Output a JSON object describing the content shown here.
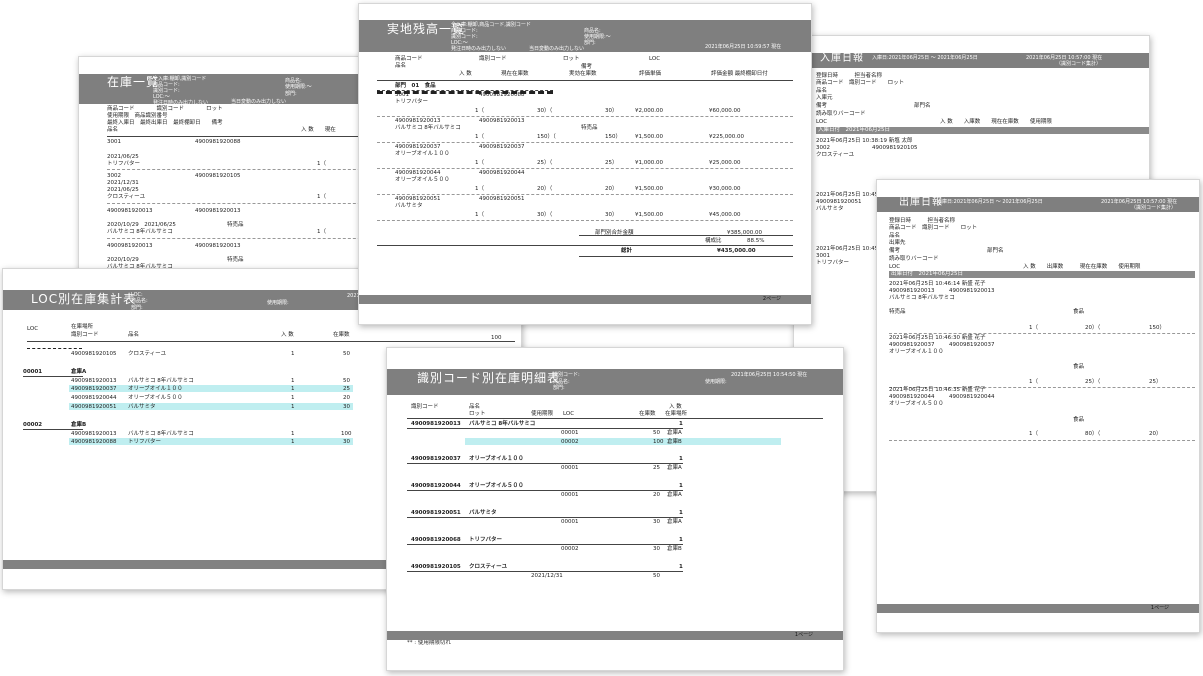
{
  "zaiko": {
    "title": "在庫一覧",
    "hdr_l": [
      "全入庫:棚卸,識別コード",
      "商品コード:",
      "識別コード:",
      "LOC:〜",
      "発注日時のみ出力しない"
    ],
    "hdr_m": "当日変動のみ出力しない",
    "hdr_r": [
      "商品名:",
      "使用期限:〜",
      "部門:"
    ],
    "cols1": [
      "商品コード",
      "識別コード",
      "ロット"
    ],
    "cols2": [
      "使用期限",
      "商品識別番号"
    ],
    "cols3": [
      "最終入庫日",
      "最終出庫日",
      "最終棚卸日",
      "備考"
    ],
    "cols4": [
      "品名",
      "入 数",
      "現在"
    ],
    "rows": [
      {
        "a": "3001",
        "b": "4900981920088"
      },
      {
        "a": "2021/06/25"
      },
      {
        "a": "トリフバター",
        "q": "1（"
      },
      {
        "a": "3002",
        "b": "4900981920105"
      },
      {
        "a": "2021/12/31"
      },
      {
        "a": "2021/06/25"
      },
      {
        "a": "クロスティーユ",
        "q": "1（"
      },
      {
        "a": "4900981920013",
        "b": "4900981920013"
      },
      {
        "a": "2020/10/29　2021/06/25",
        "c": "特売品"
      },
      {
        "a": "バルサミコ 8年バルサミコ",
        "q": "1（"
      },
      {
        "a": "4900981920013",
        "b": "4900981920013"
      },
      {
        "a": "2020/10/29",
        "c": "特売品"
      },
      {
        "a": "バルサミコ 8年バルサミコ"
      }
    ]
  },
  "jitchi": {
    "title": "実地残高一覧",
    "hdr_l": [
      "全入庫:棚卸,商品コード,識別コード",
      "商品コード:",
      "識別コード:",
      "LOC:〜",
      "発注日時のみ出力しない"
    ],
    "hdr_m": "当日変動のみ出力しない",
    "hdr_r": [
      "商品名:",
      "使用期限:〜",
      "部門:"
    ],
    "date": "2021年06月25日 10:59:57 現在",
    "cols1": [
      "商品コード",
      "識別コード",
      "ロット",
      "LOC"
    ],
    "cols2": [
      "品名",
      "備考"
    ],
    "cols3": [
      "入 数",
      "現在在庫数",
      "実効在庫数",
      "評価単価",
      "評価金額 最終棚卸日付"
    ],
    "dept": "部門　01　食品",
    "items": [
      {
        "code": "3001",
        "id": "4900981920088",
        "name": "トリフバター",
        "memo": "",
        "q": "1（",
        "c1": "30）（",
        "c2": "30）",
        "price": "¥2,000.00",
        "amt": "¥60,000.00"
      },
      {
        "code": "4900981920013",
        "id": "4900981920013",
        "name": "バルサミコ 8年バルサミコ",
        "memo": "特売品",
        "q": "1（",
        "c1": "150）（",
        "c2": "150）",
        "price": "¥1,500.00",
        "amt": "¥225,000.00"
      },
      {
        "code": "4900981920037",
        "id": "4900981920037",
        "name": "オリーブオイル１００",
        "memo": "",
        "q": "1（",
        "c1": "25）（",
        "c2": "25）",
        "price": "¥1,000.00",
        "amt": "¥25,000.00"
      },
      {
        "code": "4900981920044",
        "id": "4900981920044",
        "name": "オリーブオイル５００",
        "memo": "",
        "q": "1（",
        "c1": "20）（",
        "c2": "20）",
        "price": "¥1,500.00",
        "amt": "¥30,000.00"
      },
      {
        "code": "4900981920051",
        "id": "4900981920051",
        "name": "バルサミタ",
        "memo": "",
        "q": "1（",
        "c1": "30）（",
        "c2": "30）",
        "price": "¥1,500.00",
        "amt": "¥45,000.00"
      }
    ],
    "subtotal_label": "部門別合計金額",
    "subtotal": "¥385,000.00",
    "ratio_label": "構成比",
    "ratio": "88.5%",
    "total_label": "総計",
    "total": "¥435,000.00",
    "page": "2ページ"
  },
  "nyuko": {
    "title": "入庫日報",
    "hdr": "入庫日:2021年06月25日 〜 2021年06月25日",
    "date": "2021年06月25日 10:57:00 現在",
    "sub": "（識別コード集計）",
    "lbl1": [
      "登録日時",
      "担当者名称"
    ],
    "lbl2": [
      "商品コード",
      "識別コード",
      "ロット"
    ],
    "lbl3": [
      "品名",
      "入庫元"
    ],
    "lbl4": [
      "備考",
      "部門名"
    ],
    "lbl5": [
      "読み取りバーコード"
    ],
    "lbl6": [
      "LOC",
      "入 数",
      "入庫数",
      "現在在庫数",
      "使用期限"
    ],
    "grp": "入庫日付　2021年06月25日",
    "r1": "2021年06月25日 10:38:19 新塩 太郎",
    "r2": "3002",
    "r2b": "4900981920105",
    "r3": "クロスティーユ",
    "r4": "2021年06月25日 10:45:1",
    "r5": "4900981920051",
    "r6": "バルサミタ",
    "r7": "2021年06月25日 10:45:1",
    "r8": "3001",
    "r9": "トリフバター"
  },
  "loc": {
    "title": "LOC別在庫集計表",
    "hdr_l": [
      "LOC:",
      "商品名:",
      "部門:"
    ],
    "hdr_r": "使用期限:",
    "date": "2021",
    "cols1": [
      "在庫場所"
    ],
    "cols2": [
      "LOC",
      "識別コード",
      "品名",
      "入 数",
      "在庫数"
    ],
    "side": "100",
    "rows0": [
      {
        "id": "4900981920105",
        "name": "クロスティーユ",
        "q": "1",
        "n": "50"
      }
    ],
    "g1": "00001",
    "g1n": "倉庫A",
    "rows1": [
      {
        "id": "4900981920013",
        "name": "バルサミコ 8年バルサミコ",
        "q": "1",
        "n": "50"
      },
      {
        "id": "4900981920037",
        "name": "オリーブオイル１００",
        "q": "1",
        "n": "25"
      },
      {
        "id": "4900981920044",
        "name": "オリーブオイル５００",
        "q": "1",
        "n": "20"
      },
      {
        "id": "4900981920051",
        "name": "バルサミタ",
        "q": "1",
        "n": "30"
      }
    ],
    "g2": "00002",
    "g2n": "倉庫B",
    "rows2": [
      {
        "id": "4900981920013",
        "name": "バルサミコ 8年バルサミコ",
        "q": "1",
        "n": "100"
      },
      {
        "id": "4900981920088",
        "name": "トリフバター",
        "q": "1",
        "n": "30"
      }
    ]
  },
  "shiki": {
    "title": "識別コード別在庫明細表",
    "hdr_l": [
      "識別コード:",
      "商品名:",
      "部門:"
    ],
    "hdr_r": "使用期限:",
    "date": "2021年06月25日 10:54:50 現在",
    "cols": [
      "識別コード",
      "品名",
      "入 数"
    ],
    "cols2": [
      "ロット",
      "使用期限",
      "LOC",
      "在庫数",
      "在庫場所"
    ],
    "items": [
      {
        "id": "4900981920013",
        "name": "バルサミコ 8年バルサミコ",
        "q": "1",
        "rows": [
          {
            "loc": "00001",
            "n": "50",
            "p": "倉庫A"
          },
          {
            "loc": "00002",
            "n": "100",
            "p": "倉庫B"
          }
        ]
      },
      {
        "id": "4900981920037",
        "name": "オリーブオイル１００",
        "q": "1",
        "rows": [
          {
            "loc": "00001",
            "n": "25",
            "p": "倉庫A"
          }
        ]
      },
      {
        "id": "4900981920044",
        "name": "オリーブオイル５００",
        "q": "1",
        "rows": [
          {
            "loc": "00001",
            "n": "20",
            "p": "倉庫A"
          }
        ]
      },
      {
        "id": "4900981920051",
        "name": "バルサミタ",
        "q": "1",
        "rows": [
          {
            "loc": "00001",
            "n": "30",
            "p": "倉庫A"
          }
        ]
      },
      {
        "id": "4900981920068",
        "name": "トリフバター",
        "q": "1",
        "rows": [
          {
            "loc": "00002",
            "n": "30",
            "p": "倉庫B"
          }
        ]
      },
      {
        "id": "4900981920105",
        "name": "クロスティーユ",
        "q": "1",
        "rows": [
          {
            "lot": "2021/12/31",
            "n": "50"
          }
        ]
      }
    ],
    "note": "** : 使用期限切れ",
    "page": "1ページ"
  },
  "shukko": {
    "title": "出庫日報",
    "hdr": "出庫日:2021年06月25日 〜 2021年06月25日",
    "date": "2021年06月25日 10:57:00 現在",
    "sub": "（識別コード集計）",
    "lbl1": [
      "登録日時",
      "担当者名称"
    ],
    "lbl2": [
      "商品コード",
      "識別コード",
      "ロット"
    ],
    "lbl3": [
      "品名",
      "出庫先"
    ],
    "lbl4": [
      "備考",
      "部門名"
    ],
    "lbl5": [
      "読み取りバーコード"
    ],
    "lbl6": [
      "LOC",
      "入 数",
      "出庫数",
      "現在在庫数",
      "使用期限"
    ],
    "grp": "出庫日付　2021年06月25日",
    "entries": [
      {
        "d": "2021年06月25日 10:46:14 新盛 花子",
        "id": "4900981920013",
        "id2": "4900981920013",
        "name": "バルサミコ 8年バルサミコ",
        "memo": "特売品",
        "sub": "食品",
        "q": "1（",
        "o": "20）（",
        "n": "150）"
      },
      {
        "d": "2021年06月25日 10:46:30 新盛 花子",
        "id": "4900981920037",
        "id2": "4900981920037",
        "name": "オリーブオイル１００",
        "memo": "",
        "sub": "食品",
        "q": "1（",
        "o": "25）（",
        "n": "25）"
      },
      {
        "d": "2021年06月25日 10:46:35 新盛 花子",
        "id": "4900981920044",
        "id2": "4900981920044",
        "name": "オリーブオイル５００",
        "memo": "",
        "sub": "食品",
        "q": "1（",
        "o": "80）（",
        "n": "20）"
      }
    ],
    "page": "1ページ"
  }
}
